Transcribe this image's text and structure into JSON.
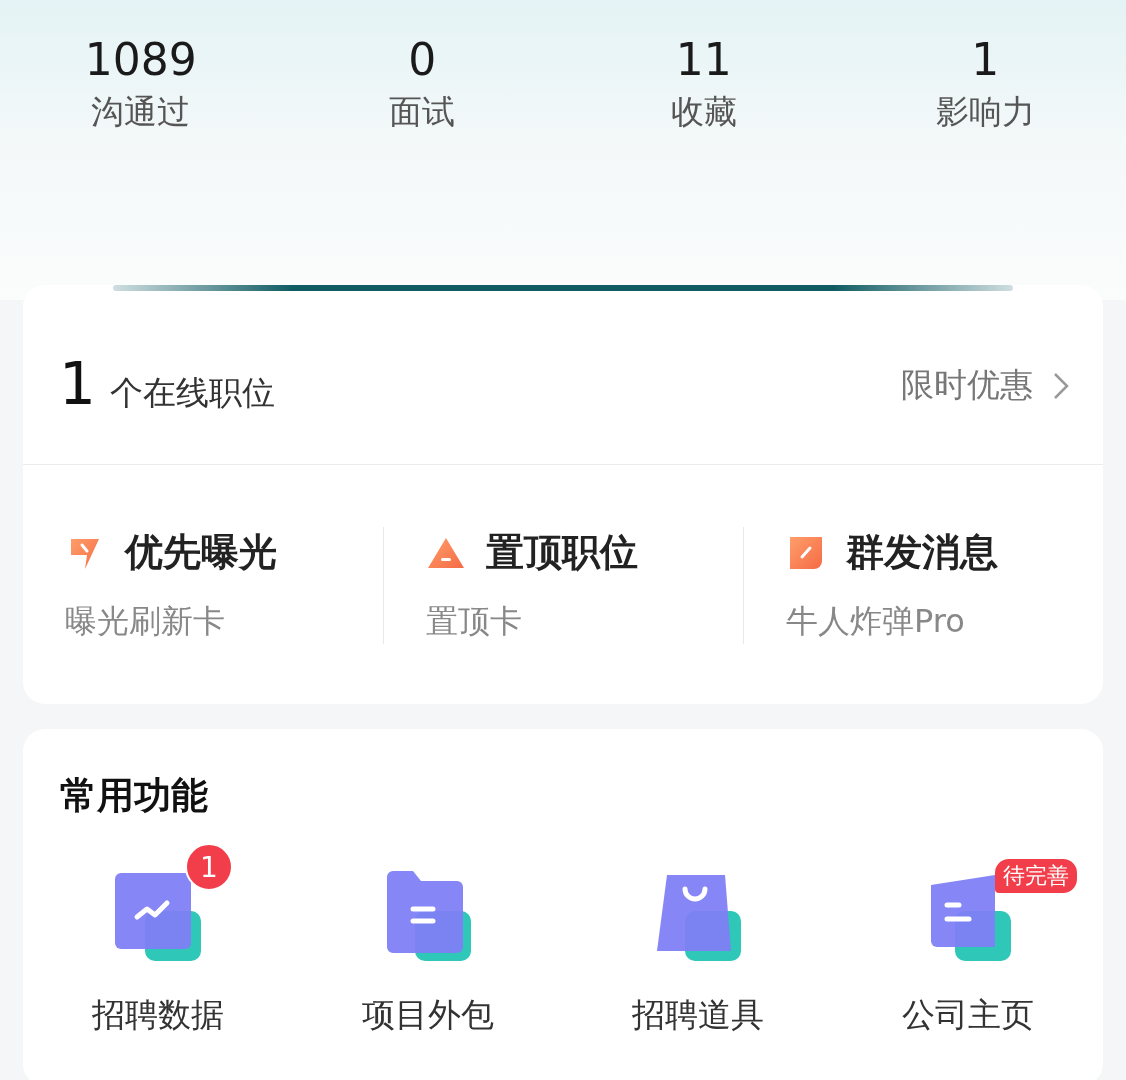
{
  "stats": [
    {
      "value": "1089",
      "label": "沟通过"
    },
    {
      "value": "0",
      "label": "面试"
    },
    {
      "value": "11",
      "label": "收藏"
    },
    {
      "value": "1",
      "label": "影响力"
    }
  ],
  "jobs": {
    "count": "1",
    "label": "个在线职位",
    "promo": "限时优惠"
  },
  "promotions": [
    {
      "kind": "bolt",
      "title": "优先曝光",
      "subtitle": "曝光刷新卡"
    },
    {
      "kind": "triangle",
      "title": "置顶职位",
      "subtitle": "置顶卡"
    },
    {
      "kind": "bubble",
      "title": "群发消息",
      "subtitle": "牛人炸弹Pro"
    }
  ],
  "functions": {
    "title": "常用功能",
    "items": [
      {
        "kind": "chart",
        "label": "招聘数据",
        "badge": {
          "kind": "count",
          "text": "1"
        }
      },
      {
        "kind": "folder",
        "label": "项目外包"
      },
      {
        "kind": "bag",
        "label": "招聘道具"
      },
      {
        "kind": "card",
        "label": "公司主页",
        "badge": {
          "kind": "tag",
          "text": "待完善"
        }
      }
    ]
  }
}
